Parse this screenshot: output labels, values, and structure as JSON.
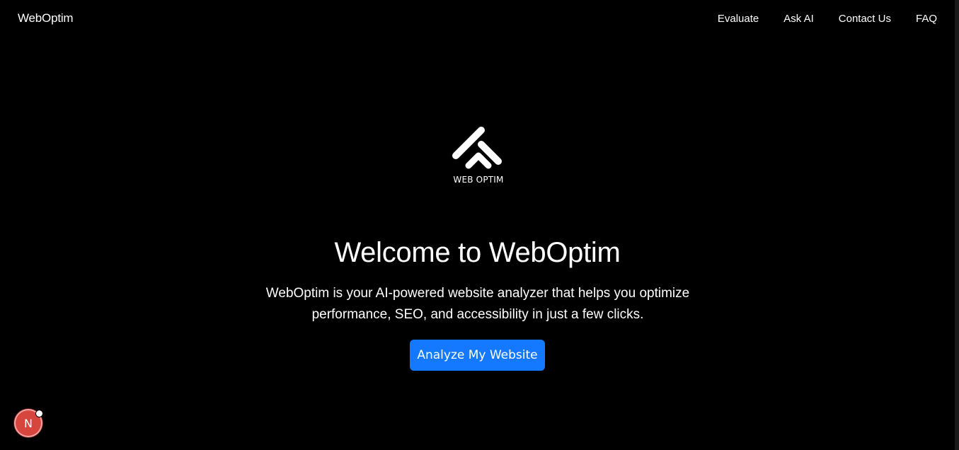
{
  "navbar": {
    "brand": "WebOptim",
    "links": [
      "Evaluate",
      "Ask AI",
      "Contact Us",
      "FAQ"
    ]
  },
  "logo": {
    "icon": "webopim-chevron-logo-icon",
    "text": "WEB OPTIM"
  },
  "hero": {
    "title": "Welcome to WebOptim",
    "description_line1": "WebOptim is your AI-powered website analyzer that helps you optimize",
    "description_line2": "performance, SEO, and accessibility in just a few clicks.",
    "cta_label": "Analyze My Website"
  },
  "dev_badge": {
    "letter": "N",
    "icon": "nextjs-icon"
  },
  "colors": {
    "background": "#000000",
    "text": "#ffffff",
    "accent": "#1479ff",
    "badge": "#d6463f"
  }
}
